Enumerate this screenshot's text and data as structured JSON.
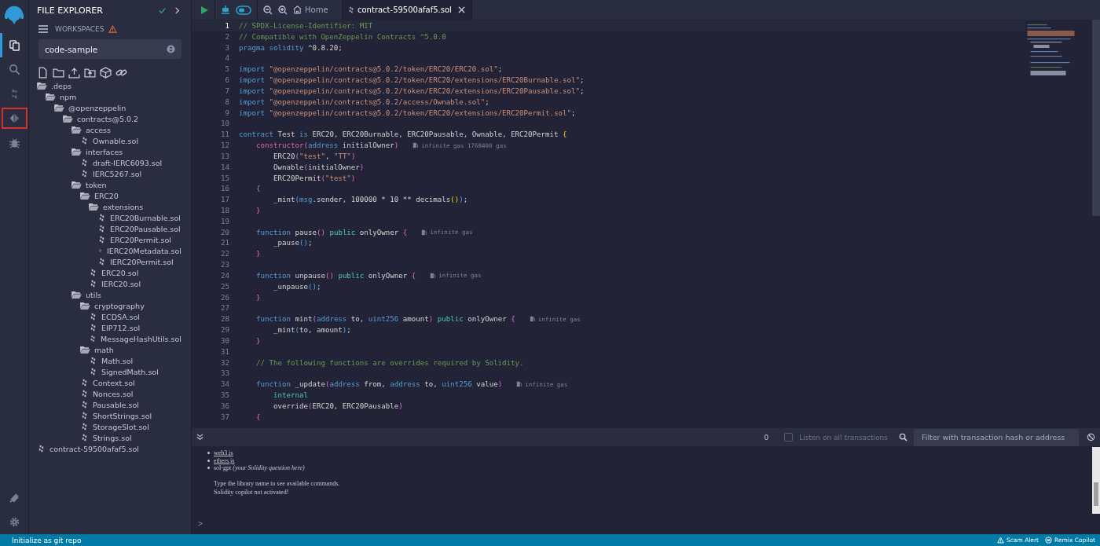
{
  "activity_bar": {
    "items": [
      {
        "kind": "files",
        "selected": true,
        "highlighted": false
      },
      {
        "kind": "search",
        "selected": false,
        "highlighted": false
      },
      {
        "kind": "compiler",
        "selected": false,
        "highlighted": false
      },
      {
        "kind": "deploy",
        "selected": false,
        "highlighted": true
      },
      {
        "kind": "debugger",
        "selected": false,
        "highlighted": false
      }
    ],
    "bottom_items": [
      {
        "kind": "plugins"
      },
      {
        "kind": "settings"
      }
    ]
  },
  "sidebar": {
    "title": "FILE EXPLORER",
    "workspaces_label": "WORKSPACES",
    "workspace": "code-sample",
    "tree": [
      {
        "name": ".deps",
        "kind": "folder",
        "expanded": true,
        "children": [
          {
            "name": "npm",
            "kind": "folder",
            "expanded": true,
            "children": [
              {
                "name": "@openzeppelin",
                "kind": "folder",
                "expanded": true,
                "children": [
                  {
                    "name": "contracts@5.0.2",
                    "kind": "folder",
                    "expanded": true,
                    "children": [
                      {
                        "name": "access",
                        "kind": "folder",
                        "expanded": true,
                        "children": [
                          {
                            "name": "Ownable.sol",
                            "kind": "file"
                          }
                        ]
                      },
                      {
                        "name": "interfaces",
                        "kind": "folder",
                        "expanded": true,
                        "children": [
                          {
                            "name": "draft-IERC6093.sol",
                            "kind": "file"
                          },
                          {
                            "name": "IERC5267.sol",
                            "kind": "file"
                          }
                        ]
                      },
                      {
                        "name": "token",
                        "kind": "folder",
                        "expanded": true,
                        "children": [
                          {
                            "name": "ERC20",
                            "kind": "folder",
                            "expanded": true,
                            "children": [
                              {
                                "name": "extensions",
                                "kind": "folder",
                                "expanded": true,
                                "children": [
                                  {
                                    "name": "ERC20Burnable.sol",
                                    "kind": "file"
                                  },
                                  {
                                    "name": "ERC20Pausable.sol",
                                    "kind": "file"
                                  },
                                  {
                                    "name": "ERC20Permit.sol",
                                    "kind": "file"
                                  },
                                  {
                                    "name": "IERC20Metadata.sol",
                                    "kind": "file"
                                  },
                                  {
                                    "name": "IERC20Permit.sol",
                                    "kind": "file"
                                  }
                                ]
                              },
                              {
                                "name": "ERC20.sol",
                                "kind": "file"
                              },
                              {
                                "name": "IERC20.sol",
                                "kind": "file"
                              }
                            ]
                          }
                        ]
                      },
                      {
                        "name": "utils",
                        "kind": "folder",
                        "expanded": true,
                        "children": [
                          {
                            "name": "cryptography",
                            "kind": "folder",
                            "expanded": true,
                            "children": [
                              {
                                "name": "ECDSA.sol",
                                "kind": "file"
                              },
                              {
                                "name": "EIP712.sol",
                                "kind": "file"
                              },
                              {
                                "name": "MessageHashUtils.sol",
                                "kind": "file"
                              }
                            ]
                          },
                          {
                            "name": "math",
                            "kind": "folder",
                            "expanded": true,
                            "children": [
                              {
                                "name": "Math.sol",
                                "kind": "file"
                              },
                              {
                                "name": "SignedMath.sol",
                                "kind": "file"
                              }
                            ]
                          },
                          {
                            "name": "Context.sol",
                            "kind": "file"
                          },
                          {
                            "name": "Nonces.sol",
                            "kind": "file"
                          },
                          {
                            "name": "Pausable.sol",
                            "kind": "file"
                          },
                          {
                            "name": "ShortStrings.sol",
                            "kind": "file"
                          },
                          {
                            "name": "StorageSlot.sol",
                            "kind": "file"
                          },
                          {
                            "name": "Strings.sol",
                            "kind": "file"
                          }
                        ]
                      }
                    ]
                  }
                ]
              }
            ]
          }
        ]
      },
      {
        "name": "contract-59500afaf5.sol",
        "kind": "file"
      }
    ]
  },
  "top_bar": {
    "home_tab": "Home",
    "tabs": [
      {
        "label": "contract-59500afaf5.sol",
        "selected": true
      }
    ]
  },
  "editor": {
    "lines": [
      {
        "number": "1",
        "current": true,
        "code": [
          {
            "kind": "comment",
            "text": "// SPDX-License-Identifier: MIT"
          }
        ]
      },
      {
        "number": "2",
        "current": false,
        "code": [
          {
            "kind": "comment",
            "text": "// Compatible with OpenZeppelin Contracts ^5.0.0"
          }
        ]
      },
      {
        "number": "3",
        "current": false,
        "code": [
          {
            "kind": "keyword",
            "text": "pragma solidity"
          },
          {
            "kind": "plain",
            "text": " ^0.8.20;"
          }
        ]
      },
      {
        "number": "4",
        "current": false
      },
      {
        "number": "5",
        "current": false,
        "code": [
          {
            "kind": "keyword",
            "text": "import"
          },
          {
            "kind": "string",
            "text": " \"@openzeppelin/contracts@5.0.2/token/ERC20/ERC20.sol\""
          },
          {
            "kind": "plain",
            "text": ";"
          }
        ]
      },
      {
        "number": "6",
        "current": false,
        "code": [
          {
            "kind": "keyword",
            "text": "import"
          },
          {
            "kind": "string",
            "text": " \"@openzeppelin/contracts@5.0.2/token/ERC20/extensions/ERC20Burnable.sol\""
          },
          {
            "kind": "plain",
            "text": ";"
          }
        ]
      },
      {
        "number": "7",
        "current": false,
        "code": [
          {
            "kind": "keyword",
            "text": "import"
          },
          {
            "kind": "string",
            "text": " \"@openzeppelin/contracts@5.0.2/token/ERC20/extensions/ERC20Pausable.sol\""
          },
          {
            "kind": "plain",
            "text": ";"
          }
        ]
      },
      {
        "number": "8",
        "current": false,
        "code": [
          {
            "kind": "keyword",
            "text": "import"
          },
          {
            "kind": "string",
            "text": " \"@openzeppelin/contracts@5.0.2/access/Ownable.sol\""
          },
          {
            "kind": "plain",
            "text": ";"
          }
        ]
      },
      {
        "number": "9",
        "current": false,
        "code": [
          {
            "kind": "keyword",
            "text": "import"
          },
          {
            "kind": "string",
            "text": " \"@openzeppelin/contracts@5.0.2/token/ERC20/extensions/ERC20Permit.sol\""
          },
          {
            "kind": "plain",
            "text": ";"
          }
        ]
      },
      {
        "number": "10",
        "current": false
      },
      {
        "number": "11",
        "current": false,
        "code": [
          {
            "kind": "keyword",
            "text": "contract"
          },
          {
            "kind": "plain",
            "text": " Test "
          },
          {
            "kind": "keyword",
            "text": "is"
          },
          {
            "kind": "plain",
            "text": " ERC20, ERC20Burnable, ERC20Pausable, Ownable, ERC20Permit "
          },
          {
            "kind": "bracket-c",
            "text": "{"
          }
        ]
      },
      {
        "number": "12",
        "current": false,
        "code": [
          {
            "kind": "special",
            "text": "    constructor"
          },
          {
            "kind": "bracket-a",
            "text": "("
          },
          {
            "kind": "keyword",
            "text": "address"
          },
          {
            "kind": "plain",
            "text": " initialOwner"
          },
          {
            "kind": "bracket-a",
            "text": ")"
          }
        ],
        "hint": "infinite gas 1768400 gas"
      },
      {
        "number": "13",
        "current": false,
        "code": [
          {
            "kind": "plain",
            "text": "        ERC20"
          },
          {
            "kind": "bracket-a",
            "text": "("
          },
          {
            "kind": "string",
            "text": "\"test\""
          },
          {
            "kind": "plain",
            "text": ", "
          },
          {
            "kind": "string",
            "text": "\"TT\""
          },
          {
            "kind": "bracket-a",
            "text": ")"
          }
        ]
      },
      {
        "number": "14",
        "current": false,
        "code": [
          {
            "kind": "plain",
            "text": "        Ownable"
          },
          {
            "kind": "bracket-a",
            "text": "("
          },
          {
            "kind": "plain",
            "text": "initialOwner"
          },
          {
            "kind": "bracket-a",
            "text": ")"
          }
        ]
      },
      {
        "number": "15",
        "current": false,
        "code": [
          {
            "kind": "plain",
            "text": "        ERC20Permit"
          },
          {
            "kind": "bracket-a",
            "text": "("
          },
          {
            "kind": "string",
            "text": "\"test\""
          },
          {
            "kind": "bracket-a",
            "text": ")"
          }
        ]
      },
      {
        "number": "16",
        "current": false,
        "code": [
          {
            "kind": "bracket-a",
            "text": "    {"
          }
        ]
      },
      {
        "number": "17",
        "current": false,
        "code": [
          {
            "kind": "plain",
            "text": "        _mint"
          },
          {
            "kind": "bracket-b",
            "text": "("
          },
          {
            "kind": "keyword",
            "text": "msg"
          },
          {
            "kind": "plain",
            "text": ".sender, 100000 * 10 ** decimals"
          },
          {
            "kind": "bracket-c",
            "text": "()"
          },
          {
            "kind": "bracket-b",
            "text": ")"
          },
          {
            "kind": "plain",
            "text": ";"
          }
        ]
      },
      {
        "number": "18",
        "current": false,
        "code": [
          {
            "kind": "bracket-a",
            "text": "    }"
          }
        ]
      },
      {
        "number": "19",
        "current": false
      },
      {
        "number": "20",
        "current": false,
        "code": [
          {
            "kind": "keyword",
            "text": "    function"
          },
          {
            "kind": "plain",
            "text": " pause"
          },
          {
            "kind": "bracket-a",
            "text": "()"
          },
          {
            "kind": "modifier",
            "text": " public"
          },
          {
            "kind": "plain",
            "text": " onlyOwner "
          },
          {
            "kind": "bracket-a",
            "text": "{"
          }
        ],
        "hint": "infinite gas"
      },
      {
        "number": "21",
        "current": false,
        "code": [
          {
            "kind": "plain",
            "text": "        _pause"
          },
          {
            "kind": "bracket-b",
            "text": "()"
          },
          {
            "kind": "plain",
            "text": ";"
          }
        ]
      },
      {
        "number": "22",
        "current": false,
        "code": [
          {
            "kind": "bracket-a",
            "text": "    }"
          }
        ]
      },
      {
        "number": "23",
        "current": false
      },
      {
        "number": "24",
        "current": false,
        "code": [
          {
            "kind": "keyword",
            "text": "    function"
          },
          {
            "kind": "plain",
            "text": " unpause"
          },
          {
            "kind": "bracket-a",
            "text": "()"
          },
          {
            "kind": "modifier",
            "text": " public"
          },
          {
            "kind": "plain",
            "text": " onlyOwner "
          },
          {
            "kind": "bracket-a",
            "text": "{"
          }
        ],
        "hint": "infinite gas"
      },
      {
        "number": "25",
        "current": false,
        "code": [
          {
            "kind": "plain",
            "text": "        _unpause"
          },
          {
            "kind": "bracket-b",
            "text": "()"
          },
          {
            "kind": "plain",
            "text": ";"
          }
        ]
      },
      {
        "number": "26",
        "current": false,
        "code": [
          {
            "kind": "bracket-a",
            "text": "    }"
          }
        ]
      },
      {
        "number": "27",
        "current": false
      },
      {
        "number": "28",
        "current": false,
        "code": [
          {
            "kind": "keyword",
            "text": "    function"
          },
          {
            "kind": "plain",
            "text": " mint"
          },
          {
            "kind": "bracket-a",
            "text": "("
          },
          {
            "kind": "keyword",
            "text": "address"
          },
          {
            "kind": "plain",
            "text": " to, "
          },
          {
            "kind": "keyword",
            "text": "uint256"
          },
          {
            "kind": "plain",
            "text": " amount"
          },
          {
            "kind": "bracket-a",
            "text": ")"
          },
          {
            "kind": "modifier",
            "text": " public"
          },
          {
            "kind": "plain",
            "text": " onlyOwner "
          },
          {
            "kind": "bracket-a",
            "text": "{"
          }
        ],
        "hint": "infinite gas"
      },
      {
        "number": "29",
        "current": false,
        "code": [
          {
            "kind": "plain",
            "text": "        _mint"
          },
          {
            "kind": "bracket-b",
            "text": "("
          },
          {
            "kind": "plain",
            "text": "to, amount"
          },
          {
            "kind": "bracket-b",
            "text": ")"
          },
          {
            "kind": "plain",
            "text": ";"
          }
        ]
      },
      {
        "number": "30",
        "current": false,
        "code": [
          {
            "kind": "bracket-a",
            "text": "    }"
          }
        ]
      },
      {
        "number": "31",
        "current": false
      },
      {
        "number": "32",
        "current": false,
        "code": [
          {
            "kind": "comment",
            "text": "    // The following functions are overrides required by Solidity."
          }
        ]
      },
      {
        "number": "33",
        "current": false
      },
      {
        "number": "34",
        "current": false,
        "code": [
          {
            "kind": "keyword",
            "text": "    function"
          },
          {
            "kind": "plain",
            "text": " _update"
          },
          {
            "kind": "bracket-a",
            "text": "("
          },
          {
            "kind": "keyword",
            "text": "address"
          },
          {
            "kind": "plain",
            "text": " from, "
          },
          {
            "kind": "keyword",
            "text": "address"
          },
          {
            "kind": "plain",
            "text": " to, "
          },
          {
            "kind": "keyword",
            "text": "uint256"
          },
          {
            "kind": "plain",
            "text": " value"
          },
          {
            "kind": "bracket-a",
            "text": ")"
          }
        ],
        "hint": "infinite gas"
      },
      {
        "number": "35",
        "current": false,
        "code": [
          {
            "kind": "modifier",
            "text": "        internal"
          }
        ]
      },
      {
        "number": "36",
        "current": false,
        "code": [
          {
            "kind": "plain",
            "text": "        override"
          },
          {
            "kind": "bracket-a",
            "text": "("
          },
          {
            "kind": "plain",
            "text": "ERC20, ERC20Pausable"
          },
          {
            "kind": "bracket-a",
            "text": ")"
          }
        ]
      },
      {
        "number": "37",
        "current": false,
        "code": [
          {
            "kind": "bracket-a",
            "text": "    {"
          }
        ]
      }
    ]
  },
  "terminal": {
    "count": "0",
    "listen_label": "Listen on all transactions",
    "listen_checked": false,
    "filter_placeholder": "Filter with transaction hash or address",
    "bullets": [
      {
        "text": "web3.js",
        "kind": "link"
      },
      {
        "text": "ethers.js",
        "kind": "link"
      },
      {
        "text": "sol-gpt *(your Solidity question here)*",
        "kind": "plain"
      }
    ],
    "messages": [
      "Type the library name to see available commands.",
      "Solidity copilot not activated!"
    ],
    "prompt": ">"
  },
  "status_bar": {
    "left": "Initialize as git repo",
    "items": [
      {
        "kind": "alert",
        "label": "Scam Alert"
      },
      {
        "kind": "copilot",
        "label": "Remix Copilot"
      }
    ]
  }
}
